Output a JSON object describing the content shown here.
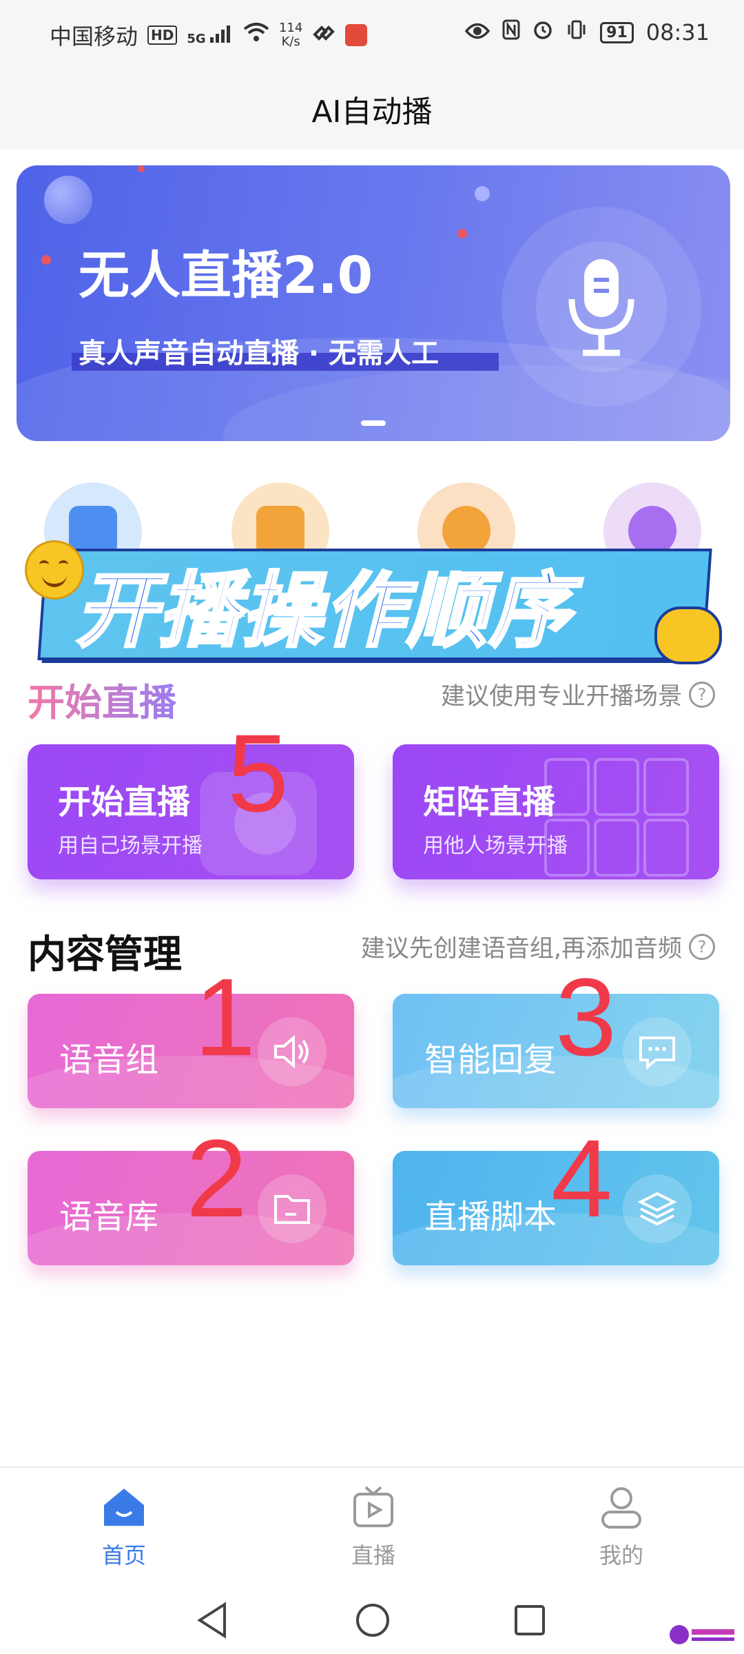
{
  "status_bar": {
    "carrier": "中国移动",
    "hd": "HD",
    "signal": "5G",
    "speed_value": "114",
    "speed_unit": "K/s",
    "battery": "91",
    "time": "08:31"
  },
  "header": {
    "title": "AI自动播"
  },
  "banner": {
    "headline": "无人直播2.0",
    "subtitle": "真人声音自动直播 · 无需人工"
  },
  "overlay": {
    "text": "开播操作顺序"
  },
  "start_section": {
    "title": "开始直播",
    "hint": "建议使用专业开播场景",
    "cards": [
      {
        "title": "开始直播",
        "subtitle": "用自己场景开播"
      },
      {
        "title": "矩阵直播",
        "subtitle": "用他人场景开播"
      }
    ]
  },
  "content_section": {
    "title": "内容管理",
    "hint": "建议先创建语音组,再添加音频",
    "cards": [
      {
        "label": "语音组",
        "icon": "speaker-icon"
      },
      {
        "label": "智能回复",
        "icon": "chat-icon"
      },
      {
        "label": "语音库",
        "icon": "folder-icon"
      },
      {
        "label": "直播脚本",
        "icon": "layers-icon"
      }
    ]
  },
  "step_numbers": [
    "5",
    "1",
    "3",
    "2",
    "4"
  ],
  "bottom_nav": {
    "items": [
      {
        "label": "首页",
        "active": true
      },
      {
        "label": "直播",
        "active": false
      },
      {
        "label": "我的",
        "active": false
      }
    ]
  },
  "colors": {
    "accent": "#3a7be8",
    "purple_card": "#9b47f5",
    "step_number": "#f03a4a",
    "inactive_nav": "#9a9a9a"
  }
}
